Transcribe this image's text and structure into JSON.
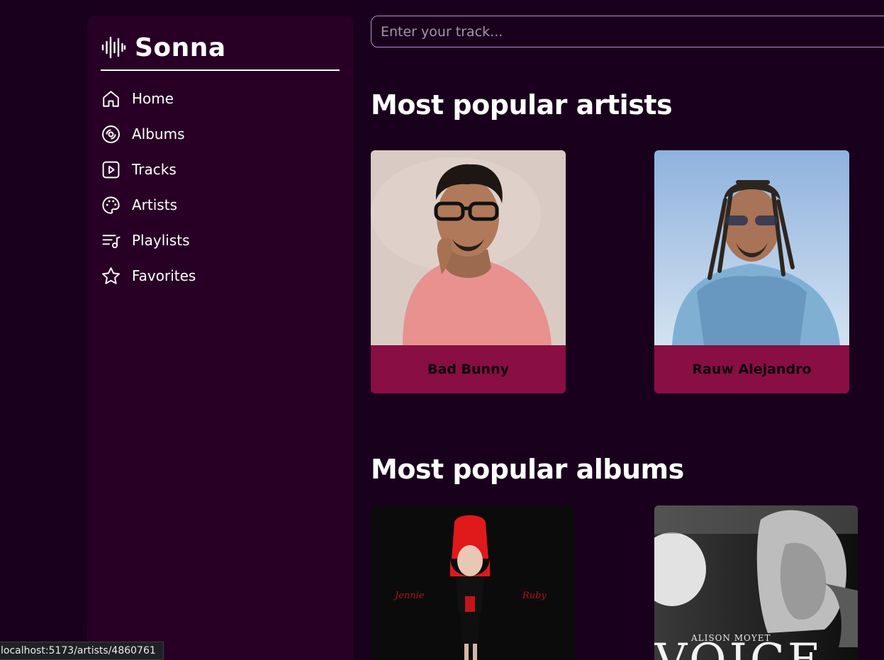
{
  "app": {
    "name": "Sonna"
  },
  "sidebar": {
    "items": [
      {
        "label": "Home",
        "icon": "home-icon"
      },
      {
        "label": "Albums",
        "icon": "disc-icon"
      },
      {
        "label": "Tracks",
        "icon": "play-square-icon"
      },
      {
        "label": "Artists",
        "icon": "palette-icon"
      },
      {
        "label": "Playlists",
        "icon": "playlist-icon"
      },
      {
        "label": "Favorites",
        "icon": "star-icon"
      }
    ]
  },
  "search": {
    "placeholder": "Enter your track..."
  },
  "sections": {
    "artists_title": "Most popular artists",
    "albums_title": "Most popular albums"
  },
  "artists": [
    {
      "name": "Bad Bunny"
    },
    {
      "name": "Rauw Alejandro"
    }
  ],
  "albums": [
    {
      "cover_text_left": "Jennie",
      "cover_text_right": "Ruby"
    },
    {
      "cover_text_top": "ALISON MOYET",
      "cover_text_big": "VOICE"
    }
  ],
  "status_bar": {
    "url": "localhost:5173/artists/4860761"
  },
  "colors": {
    "background": "#19001c",
    "sidebar": "#280026",
    "card_accent": "#880e44",
    "search_border": "#b48bd6"
  }
}
